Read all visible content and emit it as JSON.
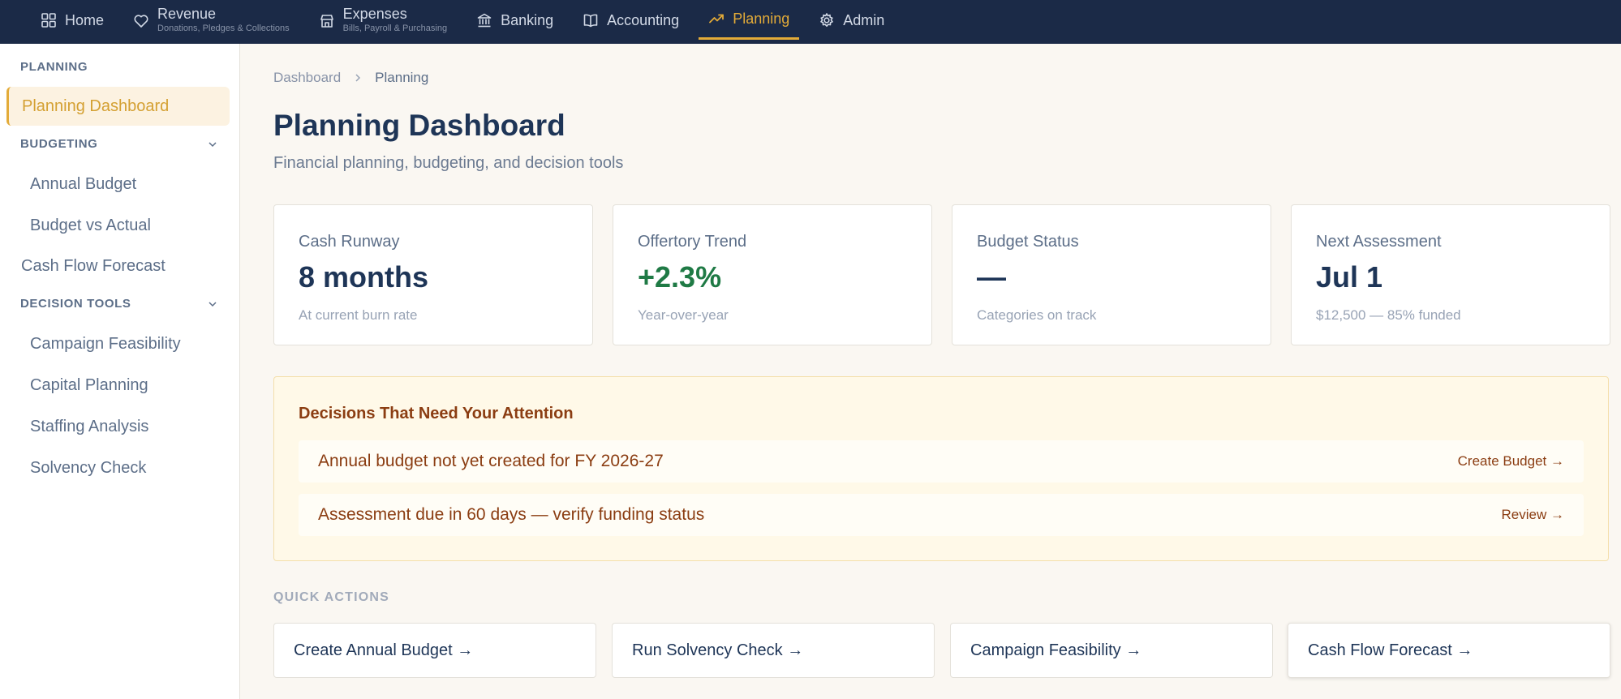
{
  "topnav": {
    "items": [
      {
        "label": "Home",
        "sub": "",
        "icon": "grid-icon",
        "active": false
      },
      {
        "label": "Revenue",
        "sub": "Donations, Pledges & Collections",
        "icon": "heart-icon",
        "active": false
      },
      {
        "label": "Expenses",
        "sub": "Bills, Payroll & Purchasing",
        "icon": "storefront-icon",
        "active": false
      },
      {
        "label": "Banking",
        "sub": "",
        "icon": "bank-icon",
        "active": false
      },
      {
        "label": "Accounting",
        "sub": "",
        "icon": "book-icon",
        "active": false
      },
      {
        "label": "Planning",
        "sub": "",
        "icon": "trending-up-icon",
        "active": true
      },
      {
        "label": "Admin",
        "sub": "",
        "icon": "gear-icon",
        "active": false
      }
    ]
  },
  "sidebar": {
    "section_title": "PLANNING",
    "dashboard_label": "Planning Dashboard",
    "budgeting": {
      "title": "BUDGETING",
      "items": [
        "Annual Budget",
        "Budget vs Actual"
      ]
    },
    "cash_flow_label": "Cash Flow Forecast",
    "decision_tools": {
      "title": "DECISION TOOLS",
      "items": [
        "Campaign Feasibility",
        "Capital Planning",
        "Staffing Analysis",
        "Solvency Check"
      ]
    }
  },
  "breadcrumb": {
    "root": "Dashboard",
    "current": "Planning"
  },
  "page": {
    "title": "Planning Dashboard",
    "subtitle": "Financial planning, budgeting, and decision tools"
  },
  "cards": [
    {
      "label": "Cash Runway",
      "value": "8 months",
      "note": "At current burn rate"
    },
    {
      "label": "Offertory Trend",
      "value": "+2.3%",
      "note": "Year-over-year"
    },
    {
      "label": "Budget Status",
      "value": "—",
      "note": "Categories on track"
    },
    {
      "label": "Next Assessment",
      "value": "Jul 1",
      "note": "$12,500 — 85% funded"
    }
  ],
  "attention": {
    "title": "Decisions That Need Your Attention",
    "rows": [
      {
        "text": "Annual budget not yet created for FY 2026-27",
        "action": "Create Budget →"
      },
      {
        "text": "Assessment due in 60 days — verify funding status",
        "action": "Review →"
      }
    ]
  },
  "quick_actions": {
    "title": "QUICK ACTIONS",
    "items": [
      "Create Annual Budget →",
      "Run Solvency Check →",
      "Campaign Feasibility →",
      "Cash Flow Forecast →"
    ]
  },
  "colors": {
    "nav_bg": "#1b2a47",
    "accent": "#e3ab38",
    "positive": "#1f7a45",
    "alert_text": "#8b3d12",
    "alert_bg": "#fff9e8"
  }
}
